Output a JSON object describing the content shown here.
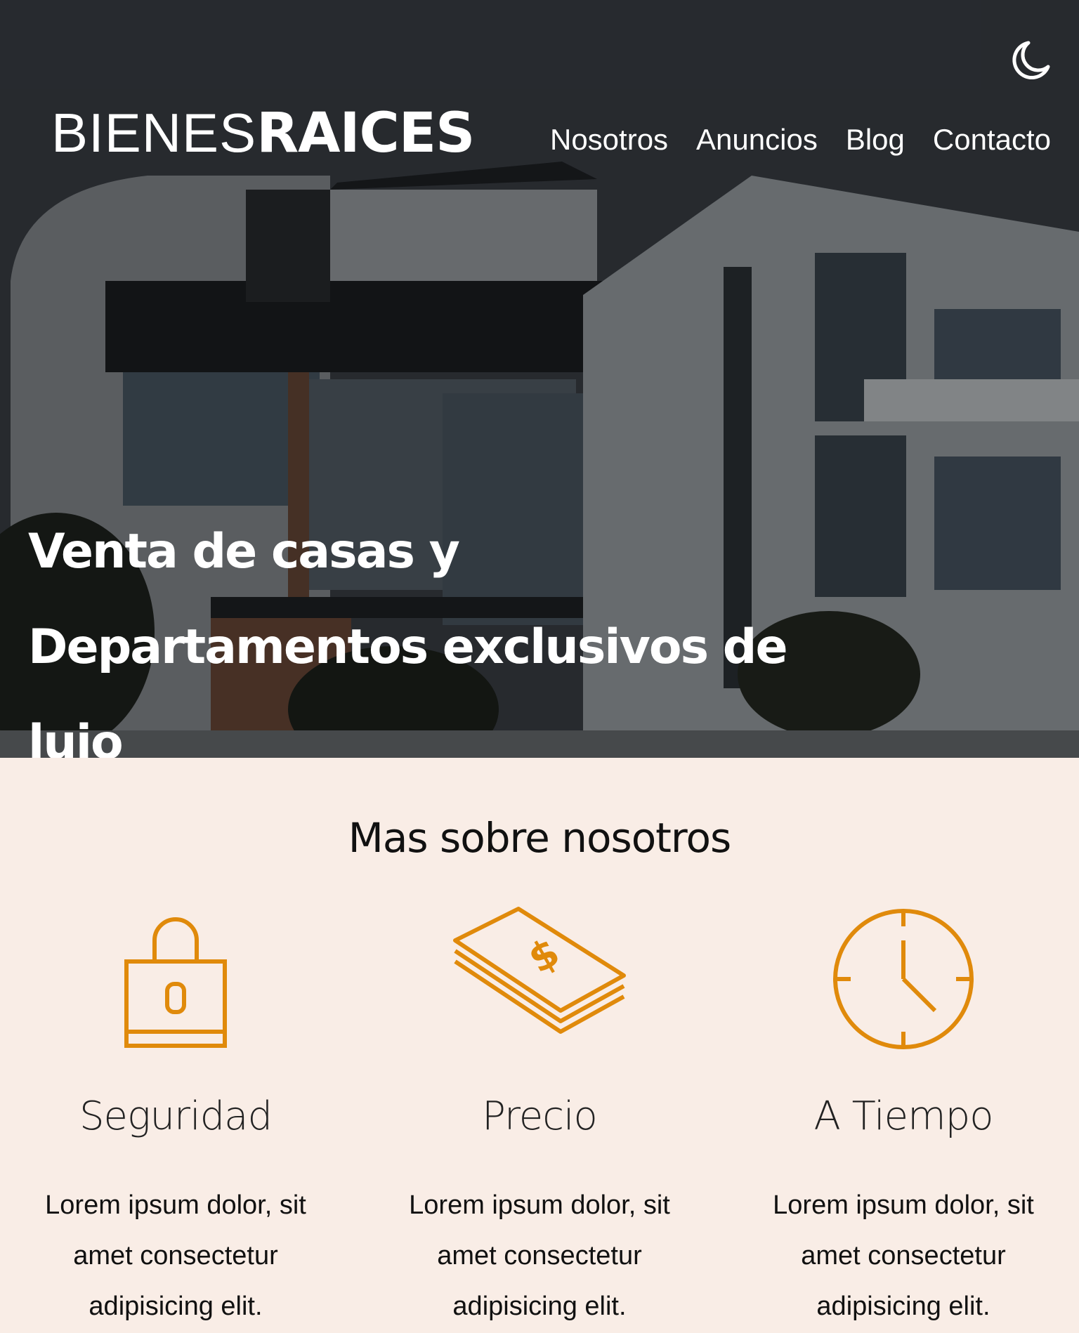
{
  "header": {
    "logo_light": "BIENES",
    "logo_bold": "RAICES",
    "theme_toggle_icon": "moon-icon",
    "nav": [
      "Nosotros",
      "Anuncios",
      "Blog",
      "Contacto"
    ]
  },
  "hero": {
    "title": "Venta de casas y Departamentos exclusivos de lujo"
  },
  "about": {
    "title": "Mas sobre nosotros",
    "features": [
      {
        "icon": "lock-icon",
        "title": "Seguridad",
        "text": "Lorem ipsum dolor, sit amet consectetur adipisicing elit."
      },
      {
        "icon": "money-icon",
        "title": "Precio",
        "text": "Lorem ipsum dolor, sit amet consectetur adipisicing elit."
      },
      {
        "icon": "clock-icon",
        "title": "A Tiempo",
        "text": "Lorem ipsum dolor, sit amet consectetur adipisicing elit."
      }
    ]
  },
  "colors": {
    "accent": "#e08a0b",
    "background": "#f9ede6"
  }
}
